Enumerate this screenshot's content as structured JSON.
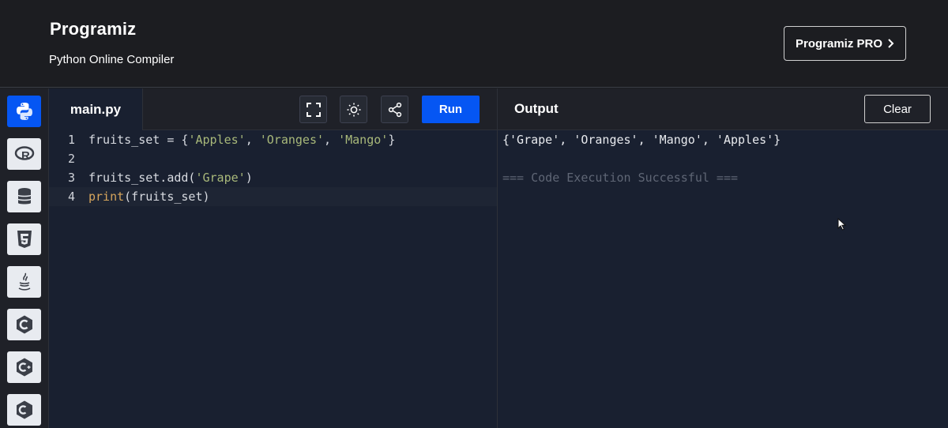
{
  "header": {
    "logo_text": "Programiz",
    "subtitle": "Python Online Compiler",
    "pro_button_label": "Programiz PRO"
  },
  "sidebar": {
    "languages": [
      {
        "icon": "python-icon",
        "active": true
      },
      {
        "icon": "r-icon",
        "active": false
      },
      {
        "icon": "sql-database-icon",
        "active": false
      },
      {
        "icon": "html5-icon",
        "active": false
      },
      {
        "icon": "java-icon",
        "active": false
      },
      {
        "icon": "c-icon",
        "active": false
      },
      {
        "icon": "cpp-icon",
        "active": false
      },
      {
        "icon": "csharp-icon",
        "active": false
      }
    ]
  },
  "editor": {
    "tab_label": "main.py",
    "run_label": "Run",
    "tools": [
      "fullscreen-icon",
      "theme-toggle-icon",
      "share-icon"
    ],
    "lines": [
      {
        "num": "1",
        "text": "fruits_set = {'Apples', 'Oranges', 'Mango'}"
      },
      {
        "num": "2",
        "text": ""
      },
      {
        "num": "3",
        "text": "fruits_set.add('Grape')"
      },
      {
        "num": "4",
        "text": "print(fruits_set)"
      }
    ]
  },
  "output": {
    "title": "Output",
    "clear_label": "Clear",
    "result_line": "{'Grape', 'Oranges', 'Mango', 'Apples'}",
    "status_line": "=== Code Execution Successful ==="
  },
  "colors": {
    "accent": "#0556f3",
    "background": "#192030",
    "string": "#a9b97a",
    "keyword": "#d6a55c"
  }
}
